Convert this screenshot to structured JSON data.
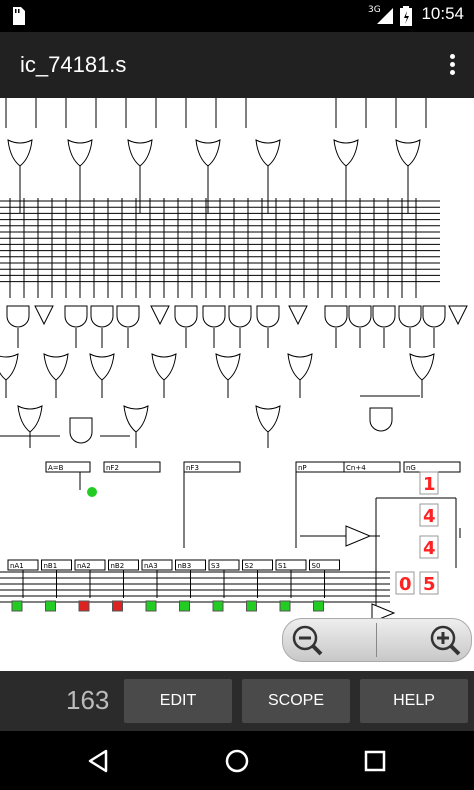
{
  "status": {
    "network": "3G",
    "time": "10:54"
  },
  "app": {
    "title": "ic_74181.s"
  },
  "circuit": {
    "labels_mid": [
      "A=B",
      "nF2",
      "nF3",
      "nP",
      "Cn+4",
      "nG"
    ],
    "inputs": [
      "nA1",
      "nB1",
      "nA2",
      "nB2",
      "nA3",
      "nB3",
      "S3",
      "S2",
      "S1",
      "S0"
    ],
    "digits": [
      "1",
      "4",
      "4",
      "0",
      "5"
    ],
    "input_states": [
      "green",
      "green",
      "red",
      "red",
      "green",
      "green",
      "green",
      "green",
      "green",
      "green"
    ]
  },
  "toolbar": {
    "count": "163",
    "edit": "EDIT",
    "scope": "SCOPE",
    "help": "HELP"
  },
  "colors": {
    "on": "#22cc22",
    "off": "#dd2222",
    "digit": "#ff2222",
    "wire": "#000000"
  }
}
